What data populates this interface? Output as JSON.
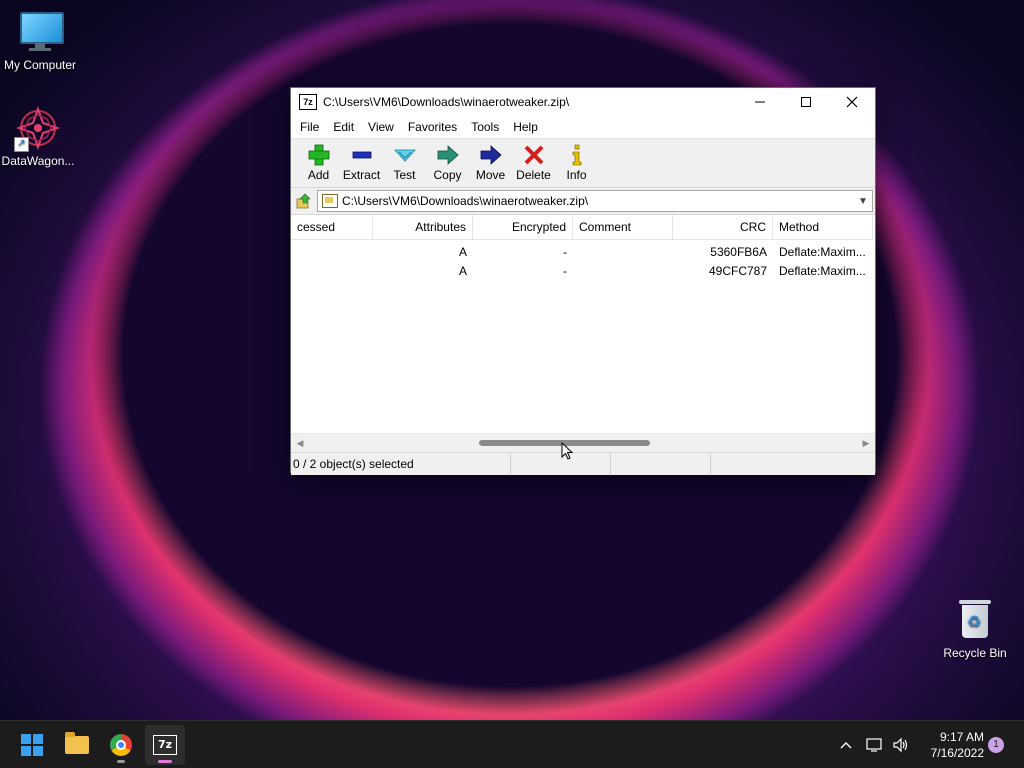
{
  "desktop": {
    "icons": [
      {
        "label": "My Computer",
        "icon": "computer-icon"
      },
      {
        "label": "DataWagon...",
        "icon": "datawagon-icon"
      },
      {
        "label": "Recycle Bin",
        "icon": "recycle-bin-icon"
      }
    ]
  },
  "window": {
    "title": "C:\\Users\\VM6\\Downloads\\winaerotweaker.zip\\",
    "app_icon_text": "7z",
    "controls": {
      "minimize": "—",
      "maximize": "☐",
      "close": "✕"
    },
    "menu": [
      "File",
      "Edit",
      "View",
      "Favorites",
      "Tools",
      "Help"
    ],
    "toolbar": [
      {
        "label": "Add",
        "icon": "add-icon",
        "color": "#22b822"
      },
      {
        "label": "Extract",
        "icon": "extract-icon",
        "color": "#1e2fbf"
      },
      {
        "label": "Test",
        "icon": "test-icon",
        "color": "#2ab6d6"
      },
      {
        "label": "Copy",
        "icon": "copy-icon",
        "color": "#2a8f78"
      },
      {
        "label": "Move",
        "icon": "move-icon",
        "color": "#1d2a9c"
      },
      {
        "label": "Delete",
        "icon": "delete-icon",
        "color": "#d81d1d"
      },
      {
        "label": "Info",
        "icon": "info-icon",
        "color": "#c9a400"
      }
    ],
    "address": "C:\\Users\\VM6\\Downloads\\winaerotweaker.zip\\",
    "columns": [
      "cessed",
      "Attributes",
      "Encrypted",
      "Comment",
      "CRC",
      "Method"
    ],
    "rows": [
      {
        "compressed": "",
        "attributes": "A",
        "encrypted": "-",
        "comment": "",
        "crc": "5360FB6A",
        "method": "Deflate:Maxim..."
      },
      {
        "compressed": "",
        "attributes": "A",
        "encrypted": "-",
        "comment": "",
        "crc": "49CFC787",
        "method": "Deflate:Maxim..."
      }
    ],
    "status": [
      "0 / 2 object(s) selected",
      "",
      "",
      ""
    ]
  },
  "taskbar": {
    "apps": [
      {
        "name": "start",
        "icon": "windows-start-icon"
      },
      {
        "name": "file-explorer",
        "icon": "folder-icon"
      },
      {
        "name": "chrome",
        "icon": "chrome-icon"
      },
      {
        "name": "7zip",
        "icon": "7zip-icon",
        "text": "7z"
      }
    ],
    "tray": {
      "chevron": "^",
      "time": "9:17 AM",
      "date": "7/16/2022",
      "notifications": "1"
    }
  }
}
